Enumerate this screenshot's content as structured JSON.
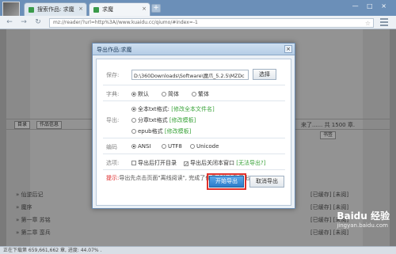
{
  "browser": {
    "tabs": [
      {
        "title": "搜索作品: 求魔",
        "active": false
      },
      {
        "title": "求魔",
        "active": true
      }
    ],
    "new_tab": "+",
    "window_controls": "— □ ×",
    "back": "←",
    "forward": "→",
    "reload": "↻",
    "url": "mz://reader/?url=http%3A//www.kuaidu.cc/qiumo/#index=-1"
  },
  "background": {
    "toolbar_items": [
      "目录",
      "作品信息"
    ],
    "toolbar_right": [
      "书签"
    ],
    "partial_text": "来了...... 共 1500 章.",
    "list": [
      {
        "title": "» 仙逆后记",
        "status": "[已缓存] [未阅]"
      },
      {
        "title": "» 魔序",
        "status": "[已缓存] [未阅]"
      },
      {
        "title": "» 第一章 苏铭",
        "status": "[已缓存] [未阅]"
      },
      {
        "title": "» 第二章 蛮兵",
        "status": "[已缓存] [未阅]"
      }
    ],
    "status_bar": "正在下载第 659,661,662 章, 进度: 44.07% .",
    "watermark_brand": "Baidu 经验",
    "watermark_url": "jingyan.baidu.com"
  },
  "dialog": {
    "title": "导出作品:求魔",
    "close": "×",
    "save_label": "保存:",
    "save_path": "D:\\360Downloads\\Software\\魔爪_5.2.5\\MZDc",
    "select_button": "选择",
    "charset_label": "字典:",
    "charset_options": [
      "默认",
      "简体",
      "繁体"
    ],
    "export_label": "导出:",
    "export_options": [
      {
        "label": "全本txt格式:",
        "link": "[修改全本文件名]"
      },
      {
        "label": "分章txt格式",
        "link": "[修改模板]"
      },
      {
        "label": "epub格式",
        "link": "[修改模板]"
      }
    ],
    "encoding_label": "编码",
    "encoding_options": [
      "ANSI",
      "UTF8",
      "Unicode"
    ],
    "options_label": "选项:",
    "option_open_dir": "导出后打开目录",
    "option_close_window": "导出后关闭本窗口",
    "option_link": "[无法导出?]",
    "tip_label": "提示:",
    "tip_text": "导出先点击页面\"离线阅读\", 完成了作品才能完整导出",
    "start_button": "开始导出",
    "cancel_button": "取消导出"
  }
}
